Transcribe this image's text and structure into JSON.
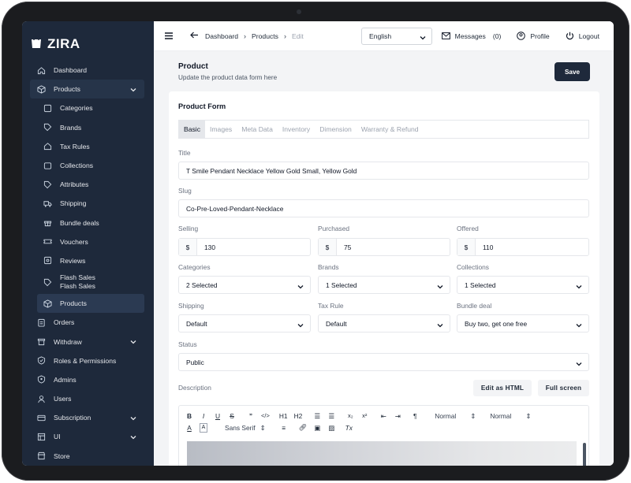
{
  "brand": {
    "name": "ZIRA"
  },
  "sidebar": {
    "items": [
      {
        "label": "Dashboard",
        "icon": "home-icon"
      },
      {
        "label": "Products",
        "icon": "box-icon",
        "expanded": true
      },
      {
        "label": "Categories",
        "icon": "grid-icon",
        "sub": true
      },
      {
        "label": "Brands",
        "icon": "tag-icon",
        "sub": true
      },
      {
        "label": "Tax Rules",
        "icon": "home-icon",
        "sub": true
      },
      {
        "label": "Collections",
        "icon": "layers-icon",
        "sub": true
      },
      {
        "label": "Attributes",
        "icon": "tag-icon",
        "sub": true
      },
      {
        "label": "Shipping",
        "icon": "truck-icon",
        "sub": true
      },
      {
        "label": "Bundle deals",
        "icon": "gift-icon",
        "sub": true
      },
      {
        "label": "Vouchers",
        "icon": "ticket-icon",
        "sub": true
      },
      {
        "label": "Reviews",
        "icon": "star-icon",
        "sub": true
      },
      {
        "label": "Flash Sales",
        "label2": "Flash Sales",
        "icon": "tags-icon",
        "sub": true
      },
      {
        "label": "Products",
        "icon": "box-icon",
        "sub": true,
        "active": true
      },
      {
        "label": "Orders",
        "icon": "clipboard-icon"
      },
      {
        "label": "Withdraw",
        "icon": "wallet-icon",
        "chevron": true
      },
      {
        "label": "Roles & Permissions",
        "icon": "shield-icon"
      },
      {
        "label": "Admins",
        "icon": "shield-user-icon"
      },
      {
        "label": "Users",
        "icon": "user-icon"
      },
      {
        "label": "Subscription",
        "icon": "card-icon",
        "chevron": true
      },
      {
        "label": "UI",
        "icon": "layout-icon",
        "chevron": true
      },
      {
        "label": "Store",
        "icon": "store-icon"
      }
    ]
  },
  "topbar": {
    "breadcrumb": [
      "Dashboard",
      "Products",
      "Edit"
    ],
    "language": "English",
    "messages_label": "Messages",
    "messages_count": "(0)",
    "profile_label": "Profile",
    "logout_label": "Logout"
  },
  "page": {
    "title": "Product",
    "subtitle": "Update the product data form here",
    "save_label": "Save"
  },
  "form": {
    "title": "Product Form",
    "tabs": [
      "Basic",
      "Images",
      "Meta Data",
      "Inventory",
      "Dimension",
      "Warranty & Refund"
    ],
    "active_tab": "Basic",
    "title_label": "Title",
    "title_value": "T Smile Pendant Necklace Yellow Gold Small, Yellow Gold",
    "slug_label": "Slug",
    "slug_value": "Co-Pre-Loved-Pendant-Necklace",
    "currency_symbol": "$",
    "selling_label": "Selling",
    "selling_value": "130",
    "purchased_label": "Purchased",
    "purchased_value": "75",
    "offered_label": "Offered",
    "offered_value": "110",
    "categories_label": "Categories",
    "categories_value": "2 Selected",
    "brands_label": "Brands",
    "brands_value": "1 Selected",
    "collections_label": "Collections",
    "collections_value": "1 Selected",
    "shipping_label": "Shipping",
    "shipping_value": "Default",
    "taxrule_label": "Tax Rule",
    "taxrule_value": "Default",
    "bundle_label": "Bundle deal",
    "bundle_value": "Buy two, get one free",
    "status_label": "Status",
    "status_value": "Public",
    "description_label": "Description",
    "edit_html_label": "Edit as HTML",
    "fullscreen_label": "Full screen"
  },
  "editor": {
    "heading1": "H1",
    "heading2": "H2",
    "normal1": "Normal",
    "normal2": "Normal",
    "font": "Sans Serif"
  },
  "colors": {
    "sidebar": "#1e293b",
    "accent": "#1e293b"
  }
}
